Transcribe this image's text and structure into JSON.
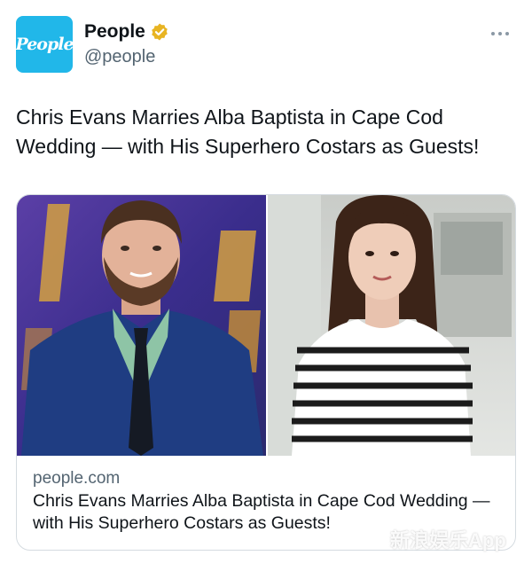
{
  "tweet": {
    "avatar_text": "People",
    "display_name": "People",
    "handle": "@people",
    "text": "Chris Evans Marries Alba Baptista in Cape Cod Wedding — with His Superhero Costars as Guests!"
  },
  "card": {
    "domain": "people.com",
    "title": "Chris Evans Marries Alba Baptista in Cape Cod Wedding — with His Superhero Costars as Guests!"
  },
  "icons": [
    "verified-badge-icon",
    "more-options-icon"
  ],
  "colors": {
    "avatar_bg": "#21b7e9",
    "verified_gold": "#e8b422",
    "secondary_text": "#536471"
  },
  "watermark": "新浪娱乐App"
}
